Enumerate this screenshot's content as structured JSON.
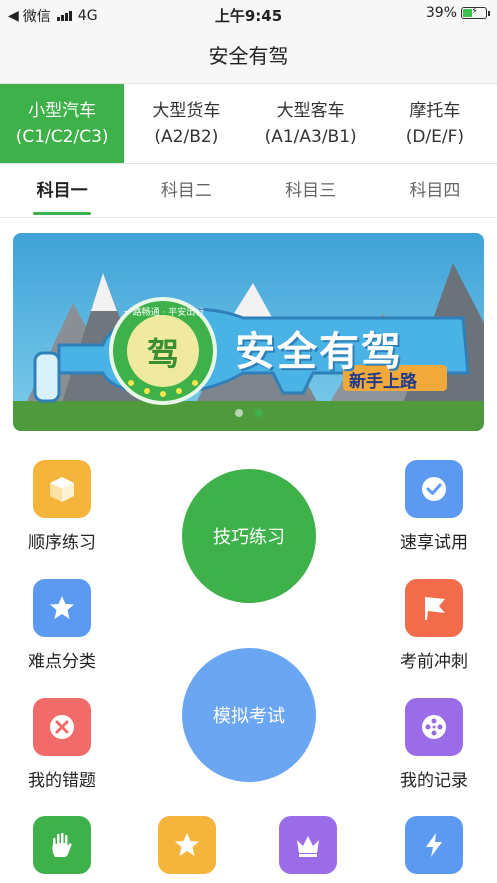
{
  "status_bar": {
    "back_label": "微信",
    "network": "4G",
    "time": "上午9:45",
    "battery": "39%"
  },
  "app_title": "安全有驾",
  "license_tabs": [
    {
      "name": "小型汽车",
      "codes": "(C1/C2/C3)",
      "active": true
    },
    {
      "name": "大型货车",
      "codes": "(A2/B2)",
      "active": false
    },
    {
      "name": "大型客车",
      "codes": "(A1/A3/B1)",
      "active": false
    },
    {
      "name": "摩托车",
      "codes": "(D/E/F)",
      "active": false
    }
  ],
  "subject_tabs": [
    {
      "label": "科目一",
      "active": true
    },
    {
      "label": "科目二",
      "active": false
    },
    {
      "label": "科目三",
      "active": false
    },
    {
      "label": "科目四",
      "active": false
    }
  ],
  "banner": {
    "headline": "安全有驾",
    "badge_char": "驾",
    "badge_ring_text": "一路畅通 · 平安出行",
    "tag": "新手上路"
  },
  "features": {
    "sequence_practice": {
      "label": "顺序练习",
      "icon": "box-icon",
      "color": "#f5b53c"
    },
    "quick_trial": {
      "label": "速享试用",
      "icon": "check-circle-icon",
      "color": "#5b9af0"
    },
    "difficulty_category": {
      "label": "难点分类",
      "icon": "star-icon",
      "color": "#5b9af0"
    },
    "pre_exam_sprint": {
      "label": "考前冲刺",
      "icon": "flag-icon",
      "color": "#f26b4a"
    },
    "my_mistakes": {
      "label": "我的错题",
      "icon": "close-circle-icon",
      "color": "#f26b6b"
    },
    "my_records": {
      "label": "我的记录",
      "icon": "film-reel-icon",
      "color": "#9b6ce8"
    }
  },
  "circle_buttons": {
    "skill_practice": {
      "label": "技巧练习",
      "color": "#3fb14a"
    },
    "mock_exam": {
      "label": "模拟考试",
      "color": "#6ba6f2"
    }
  },
  "bottom_row": [
    {
      "icon": "hand-icon",
      "color": "#3fb14a"
    },
    {
      "icon": "star-icon",
      "color": "#f5b53c"
    },
    {
      "icon": "crown-icon",
      "color": "#9b6ce8"
    },
    {
      "icon": "lightning-icon",
      "color": "#5b9af0"
    }
  ],
  "colors": {
    "accent": "#3fb14a"
  }
}
